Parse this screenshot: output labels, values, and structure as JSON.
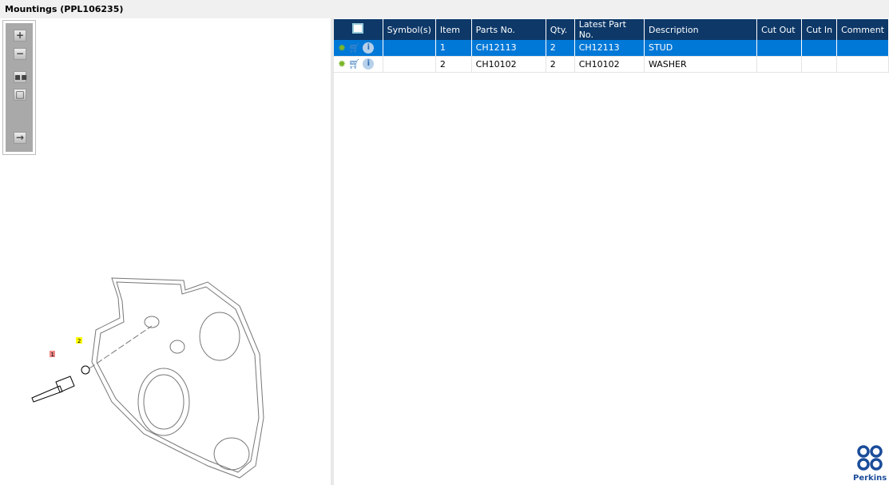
{
  "title": "Mountings (PPL106235)",
  "toolbar": {
    "buttons": [
      "zoom-in",
      "zoom-out",
      "fit-all",
      "actual-size",
      "export"
    ]
  },
  "grid": {
    "columns": [
      "Symbol(s)",
      "Item",
      "Parts No.",
      "Qty.",
      "Latest Part No.",
      "Description",
      "Cut Out",
      "Cut In",
      "Comment"
    ],
    "rows": [
      {
        "symbols": "",
        "item": "1",
        "parts_no": "CH12113",
        "qty": "2",
        "latest": "CH12113",
        "description": "STUD",
        "cut_out": "",
        "cut_in": "",
        "comment": "",
        "selected": true
      },
      {
        "symbols": "",
        "item": "2",
        "parts_no": "CH10102",
        "qty": "2",
        "latest": "CH10102",
        "description": "WASHER",
        "cut_out": "",
        "cut_in": "",
        "comment": "",
        "selected": false
      }
    ]
  },
  "diagram": {
    "callouts": [
      "1",
      "2"
    ]
  },
  "brand": {
    "name": "Perkins",
    "color": "#1b4c9a"
  },
  "colors": {
    "header": "#0d3868",
    "selected": "#0078d7"
  }
}
